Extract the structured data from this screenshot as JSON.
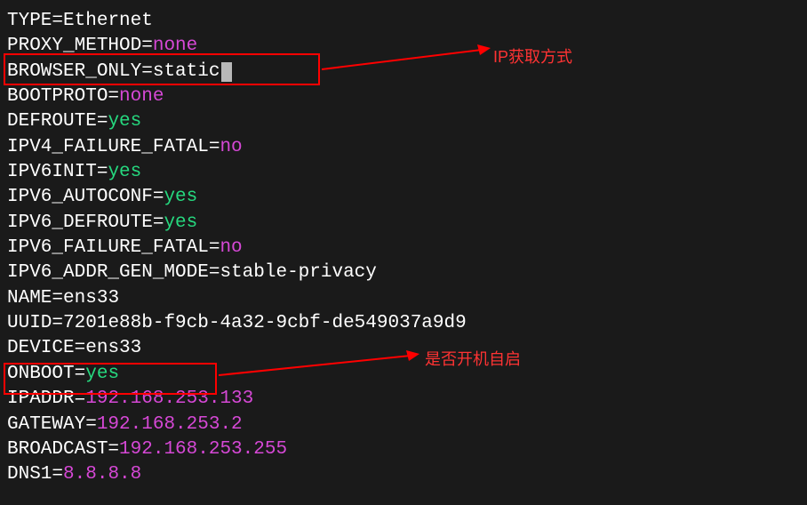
{
  "lines": [
    {
      "key": "TYPE",
      "value": "Ethernet",
      "color": "white"
    },
    {
      "key": "PROXY_METHOD",
      "value": "none",
      "color": "magenta"
    },
    {
      "key": "BROWSER_ONLY",
      "value": "static",
      "color": "white",
      "cursor": true
    },
    {
      "key": "BOOTPROTO",
      "value": "none",
      "color": "magenta"
    },
    {
      "key": "DEFROUTE",
      "value": "yes",
      "color": "green"
    },
    {
      "key": "IPV4_FAILURE_FATAL",
      "value": "no",
      "color": "magenta"
    },
    {
      "key": "IPV6INIT",
      "value": "yes",
      "color": "green"
    },
    {
      "key": "IPV6_AUTOCONF",
      "value": "yes",
      "color": "green"
    },
    {
      "key": "IPV6_DEFROUTE",
      "value": "yes",
      "color": "green"
    },
    {
      "key": "IPV6_FAILURE_FATAL",
      "value": "no",
      "color": "magenta"
    },
    {
      "key": "IPV6_ADDR_GEN_MODE",
      "value": "stable-privacy",
      "color": "white"
    },
    {
      "key": "NAME",
      "value": "ens33",
      "color": "white"
    },
    {
      "key": "UUID",
      "value": "7201e88b-f9cb-4a32-9cbf-de549037a9d9",
      "color": "white"
    },
    {
      "key": "DEVICE",
      "value": "ens33",
      "color": "white"
    },
    {
      "key": "ONBOOT",
      "value": "yes",
      "color": "green"
    },
    {
      "key": "IPADDR",
      "value": "192.168.253.133",
      "color": "magenta"
    },
    {
      "key": "GATEWAY",
      "value": "192.168.253.2",
      "color": "magenta"
    },
    {
      "key": "BROADCAST",
      "value": "192.168.253.255",
      "color": "magenta"
    },
    {
      "key": "DNS1",
      "value": "8.8.8.8",
      "color": "magenta"
    }
  ],
  "annotations": {
    "ann1": "IP获取方式",
    "ann2": "是否开机自启"
  }
}
